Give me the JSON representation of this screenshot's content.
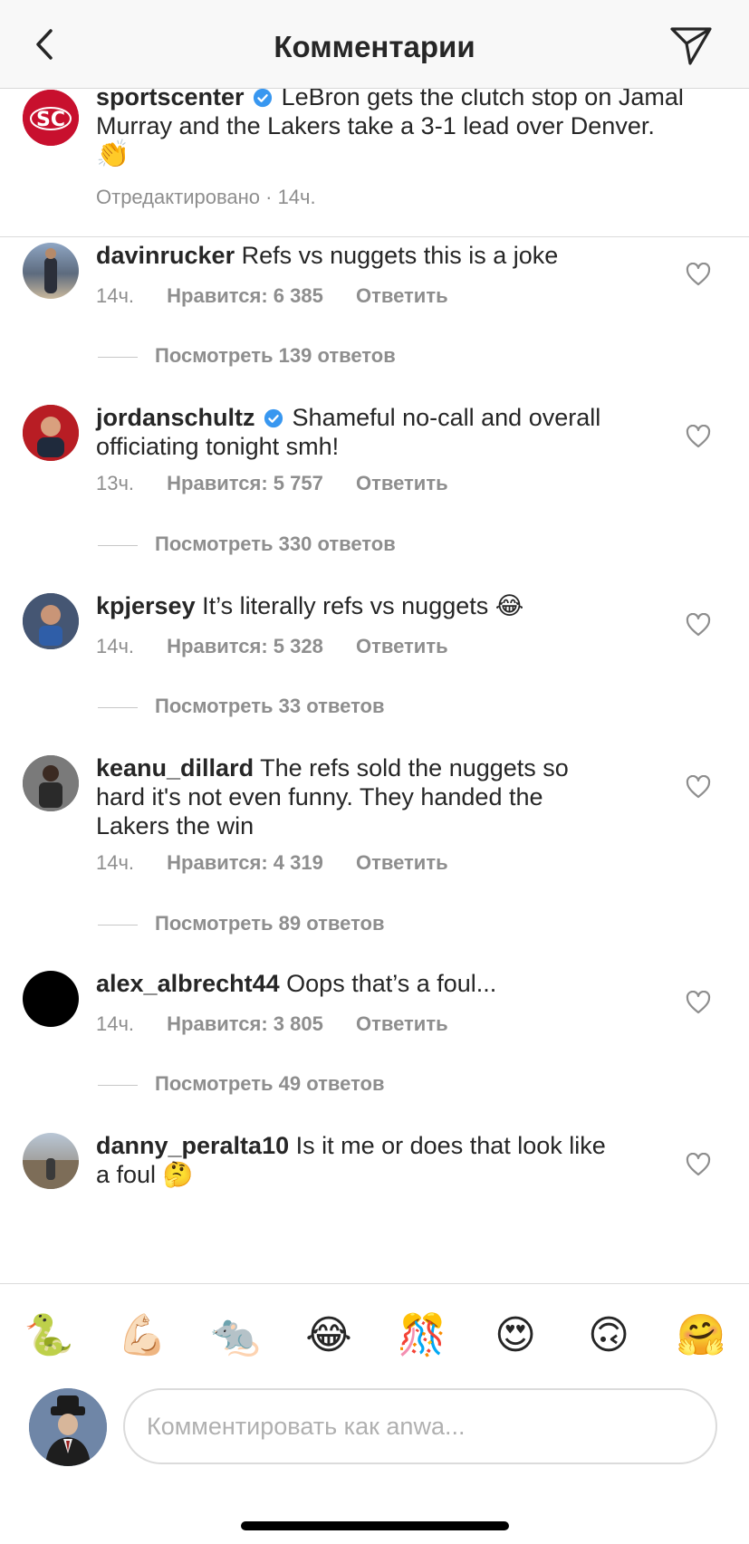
{
  "header": {
    "title": "Комментарии"
  },
  "caption": {
    "username": "sportscenter",
    "text": "LeBron gets the clutch stop on Jamal Murray and the Lakers take a 3-1 lead over Denver.",
    "emoji": "👏",
    "meta": "Отредактировано · 14ч."
  },
  "comments": [
    {
      "username": "davinrucker",
      "verified": false,
      "text": "Refs vs nuggets this is a joke",
      "time": "14ч.",
      "likes": "Нравится: 6 385",
      "reply": "Ответить",
      "view_replies": "Посмотреть 139 ответов"
    },
    {
      "username": "jordanschultz",
      "verified": true,
      "text": "Shameful no-call and overall officiating tonight smh!",
      "time": "13ч.",
      "likes": "Нравится: 5 757",
      "reply": "Ответить",
      "view_replies": "Посмотреть 330 ответов"
    },
    {
      "username": "kpjersey",
      "verified": false,
      "text": "It’s literally refs vs nuggets 😂",
      "time": "14ч.",
      "likes": "Нравится: 5 328",
      "reply": "Ответить",
      "view_replies": "Посмотреть 33 ответов"
    },
    {
      "username": "keanu_dillard",
      "verified": false,
      "text": "The refs sold the nuggets so hard it's not even funny. They handed the Lakers the win",
      "time": "14ч.",
      "likes": "Нравится: 4 319",
      "reply": "Ответить",
      "view_replies": "Посмотреть 89 ответов"
    },
    {
      "username": "alex_albrecht44",
      "verified": false,
      "text": "Oops that’s a foul...",
      "time": "14ч.",
      "likes": "Нравится: 3 805",
      "reply": "Ответить",
      "view_replies": "Посмотреть 49 ответов"
    },
    {
      "username": "danny_peralta10",
      "verified": false,
      "text": "Is it me or does that look like a foul 🤔"
    }
  ],
  "emoji_bar": [
    "🐍",
    "💪🏻",
    "🐀",
    "😂",
    "🎊",
    "😍",
    "🙃",
    "🤗"
  ],
  "composer": {
    "placeholder": "Комментировать как anwa..."
  }
}
